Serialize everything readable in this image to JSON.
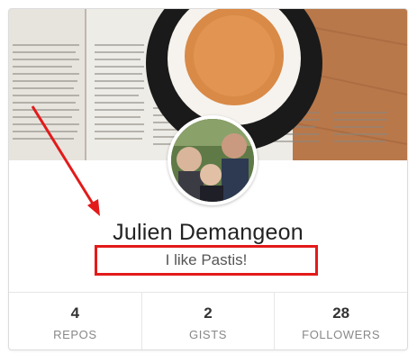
{
  "profile": {
    "name": "Julien Demangeon",
    "bio": "I like Pastis!"
  },
  "stats": [
    {
      "value": "4",
      "label": "REPOS"
    },
    {
      "value": "2",
      "label": "GISTS"
    },
    {
      "value": "28",
      "label": "FOLLOWERS"
    }
  ],
  "colors": {
    "highlight": "#e31a1a",
    "name_text": "#222222",
    "bio_text": "#555555",
    "stat_label": "#888888"
  }
}
